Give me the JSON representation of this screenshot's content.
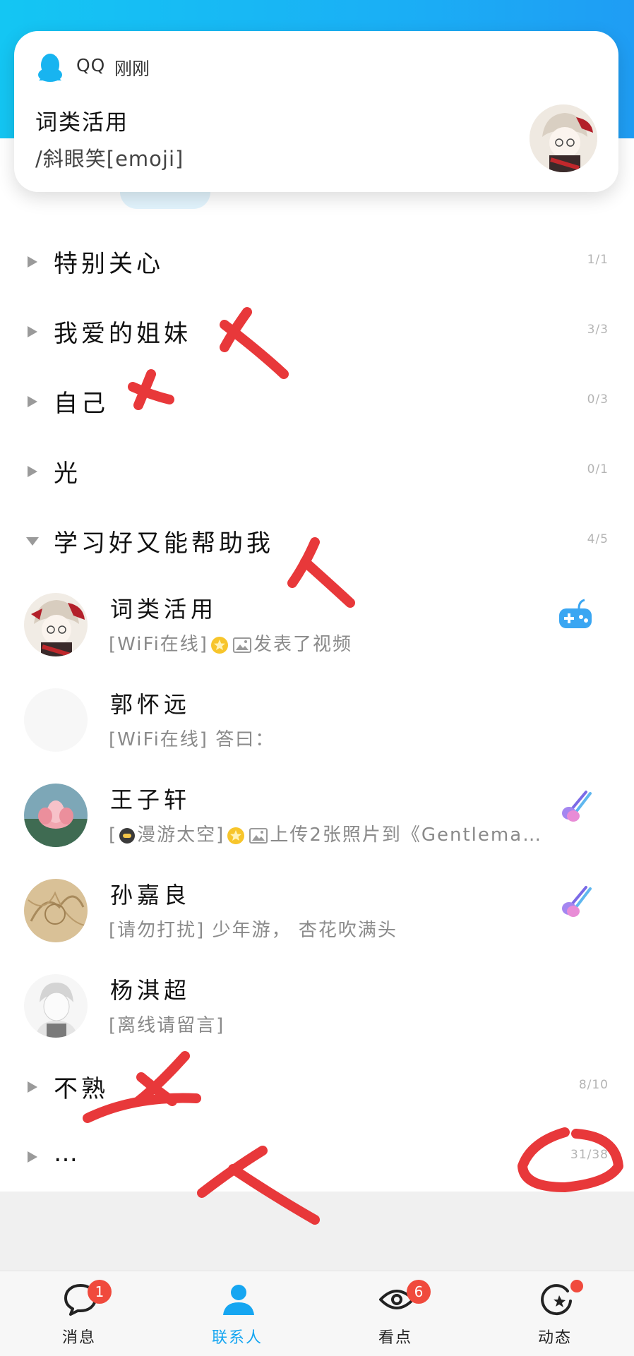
{
  "notification": {
    "app": "QQ",
    "time": "刚刚",
    "title": "词类活用",
    "body": "/斜眼笑[emoji]"
  },
  "groups": [
    {
      "name": "特别关心",
      "count": "1/1",
      "expanded": false
    },
    {
      "name": "我爱的姐妹",
      "count": "3/3",
      "expanded": false
    },
    {
      "name": "自己",
      "count": "0/3",
      "expanded": false
    },
    {
      "name": "光",
      "count": "0/1",
      "expanded": false
    },
    {
      "name": "学习好又能帮助我",
      "count": "4/5",
      "expanded": true
    },
    {
      "name": "不熟",
      "count": "8/10",
      "expanded": false
    },
    {
      "name": "…",
      "count": "31/38",
      "expanded": false
    }
  ],
  "contacts": [
    {
      "name": "词类活用",
      "status_prefix": "[WiFi在线]",
      "status_text": "发表了视频",
      "badge_icon": "game-controller-icon"
    },
    {
      "name": "郭怀远",
      "status_prefix": "[WiFi在线]",
      "status_text": "答曰："
    },
    {
      "name": "王子轩",
      "status_prefix": "[",
      "status_mid": "漫游太空]",
      "status_text": "上传2张照片到《Gentlema…",
      "badge_icon": "guitar-icon"
    },
    {
      "name": "孙嘉良",
      "status_prefix": "[请勿打扰]",
      "status_text": "少年游， 杏花吹满头",
      "badge_icon": "guitar-icon"
    },
    {
      "name": "杨淇超",
      "status_prefix": "[离线请留言]",
      "status_text": ""
    }
  ],
  "bottom_nav": [
    {
      "label": "消息",
      "badge": "1",
      "icon": "chat-bubble-icon"
    },
    {
      "label": "联系人",
      "active": true,
      "icon": "person-icon"
    },
    {
      "label": "看点",
      "badge": "6",
      "icon": "eye-icon"
    },
    {
      "label": "动态",
      "dot": true,
      "icon": "star-circle-icon"
    }
  ],
  "colors": {
    "header_blue": "#1ab0f5",
    "active_blue": "#16a6f1",
    "badge_red": "#f04a3d",
    "annotation_red": "#e8383a"
  }
}
